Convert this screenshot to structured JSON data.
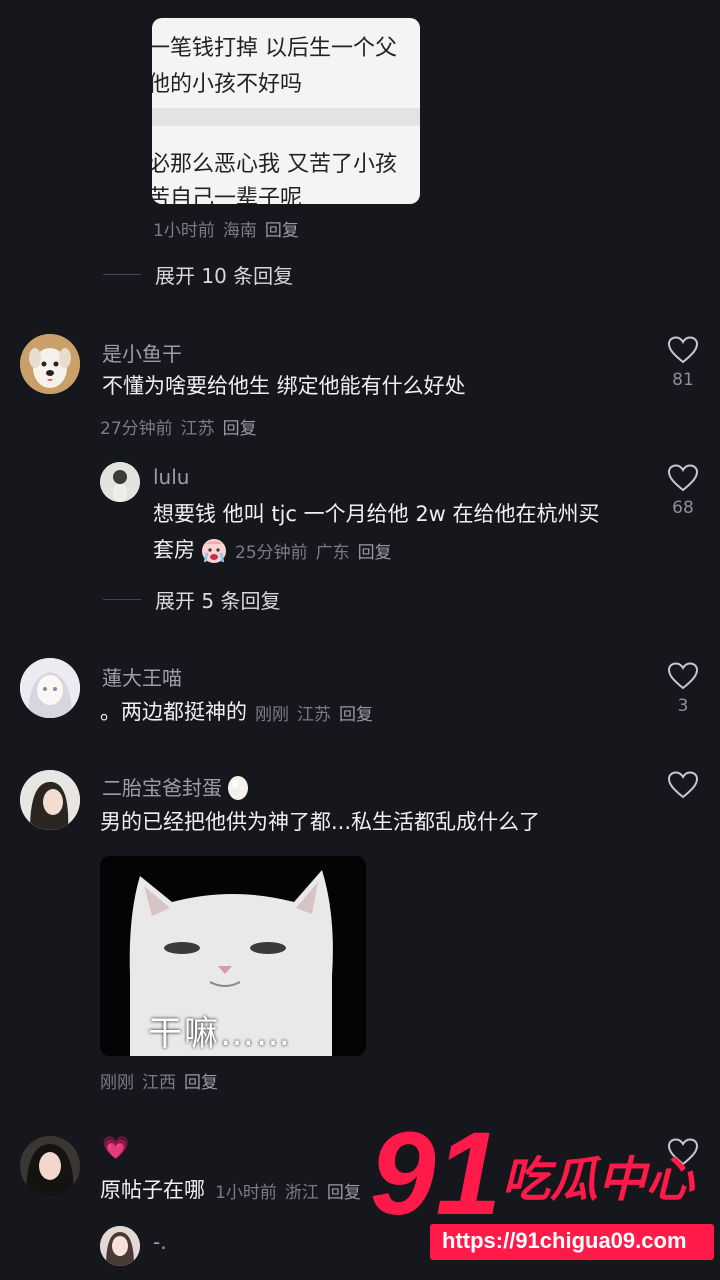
{
  "top_image": {
    "lines": [
      "一笔钱打掉 以后生一个父",
      "他的小孩不好吗",
      "必那么恶心我 又苦了小孩",
      "苦自己一辈子呢"
    ]
  },
  "top_meta": {
    "time": "1小时前",
    "location": "海南",
    "reply": "回复"
  },
  "top_expand": "展开 10 条回复",
  "comments": [
    {
      "name": "是小鱼干",
      "text": "不懂为啥要给他生  绑定他能有什么好处",
      "time": "27分钟前",
      "location": "江苏",
      "reply": "回复",
      "likes": "81"
    },
    {
      "name": "lulu",
      "text_line1": "想要钱 他叫 tjc 一个月给他 2w 在给他在杭州买",
      "text_line2": "套房",
      "time": "25分钟前",
      "location": "广东",
      "reply": "回复",
      "likes": "68"
    },
    {
      "name": "蓮大王喵",
      "text": "。两边都挺神的",
      "time": "刚刚",
      "location": "江苏",
      "reply": "回复",
      "likes": "3"
    },
    {
      "name": "二胎宝爸封蛋",
      "text": "男的已经把他供为神了都...私生活都乱成什么了",
      "meme_caption": "干嘛……",
      "time": "刚刚",
      "location": "江西",
      "reply": "回复"
    },
    {
      "name": "💗",
      "text": "原帖子在哪",
      "time": "1小时前",
      "location": "浙江",
      "reply": "回复"
    },
    {
      "name": "-."
    }
  ],
  "lulu_expand": "展开 5 条回复",
  "watermark": {
    "num": "91",
    "cn": "吃瓜中心",
    "url": "https://91chigua09.com",
    "color": "#ff1a4a"
  }
}
